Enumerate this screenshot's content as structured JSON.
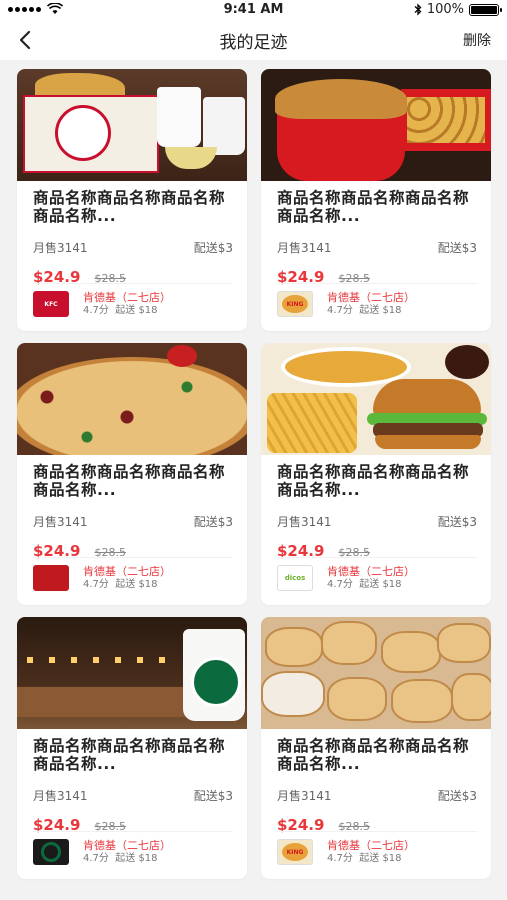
{
  "status_bar": {
    "time": "9:41 AM",
    "battery": "100%",
    "icons": [
      "signal-icon",
      "wifi-icon",
      "bluetooth-icon",
      "battery-icon"
    ]
  },
  "nav": {
    "title": "我的足迹",
    "action": "删除",
    "back_icon": "chevron-left-icon"
  },
  "colors": {
    "price": "#e8363b",
    "store_name": "#e8363b",
    "background": "#f2f2f2"
  },
  "items": [
    {
      "image": "kfc-meal",
      "title": "商品名称商品名称商品名称商品名称...",
      "sales": "月售3141",
      "delivery": "配送$3",
      "price": "$24.9",
      "old_price": "$28.5",
      "store": "肯德基（二七店）",
      "rating": "4.7分",
      "min_order": "起送 $18",
      "logo": "kfc-logo"
    },
    {
      "image": "kfc-bucket",
      "title": "商品名称商品名称商品名称商品名称...",
      "sales": "月售3141",
      "delivery": "配送$3",
      "price": "$24.9",
      "old_price": "$28.5",
      "store": "肯德基（二七店）",
      "rating": "4.7分",
      "min_order": "起送 $18",
      "logo": "burger-king-logo"
    },
    {
      "image": "pizza",
      "title": "商品名称商品名称商品名称商品名称...",
      "sales": "月售3141",
      "delivery": "配送$3",
      "price": "$24.9",
      "old_price": "$28.5",
      "store": "肯德基（二七店）",
      "rating": "4.7分",
      "min_order": "起送 $18",
      "logo": "red-logo"
    },
    {
      "image": "burger-meal",
      "title": "商品名称商品名称商品名称商品名称...",
      "sales": "月售3141",
      "delivery": "配送$3",
      "price": "$24.9",
      "old_price": "$28.5",
      "store": "肯德基（二七店）",
      "rating": "4.7分",
      "min_order": "起送 $18",
      "logo": "dicos-logo"
    },
    {
      "image": "coffee-shop",
      "title": "商品名称商品名称商品名称商品名称...",
      "sales": "月售3141",
      "delivery": "配送$3",
      "price": "$24.9",
      "old_price": "$28.5",
      "store": "肯德基（二七店）",
      "rating": "4.7分",
      "min_order": "起送 $18",
      "logo": "starbucks-logo"
    },
    {
      "image": "pastries",
      "title": "商品名称商品名称商品名称商品名称...",
      "sales": "月售3141",
      "delivery": "配送$3",
      "price": "$24.9",
      "old_price": "$28.5",
      "store": "肯德基（二七店）",
      "rating": "4.7分",
      "min_order": "起送 $18",
      "logo": "burger-king-logo"
    }
  ],
  "logo_text": {
    "dicos": "dicos",
    "bk": "KING"
  }
}
